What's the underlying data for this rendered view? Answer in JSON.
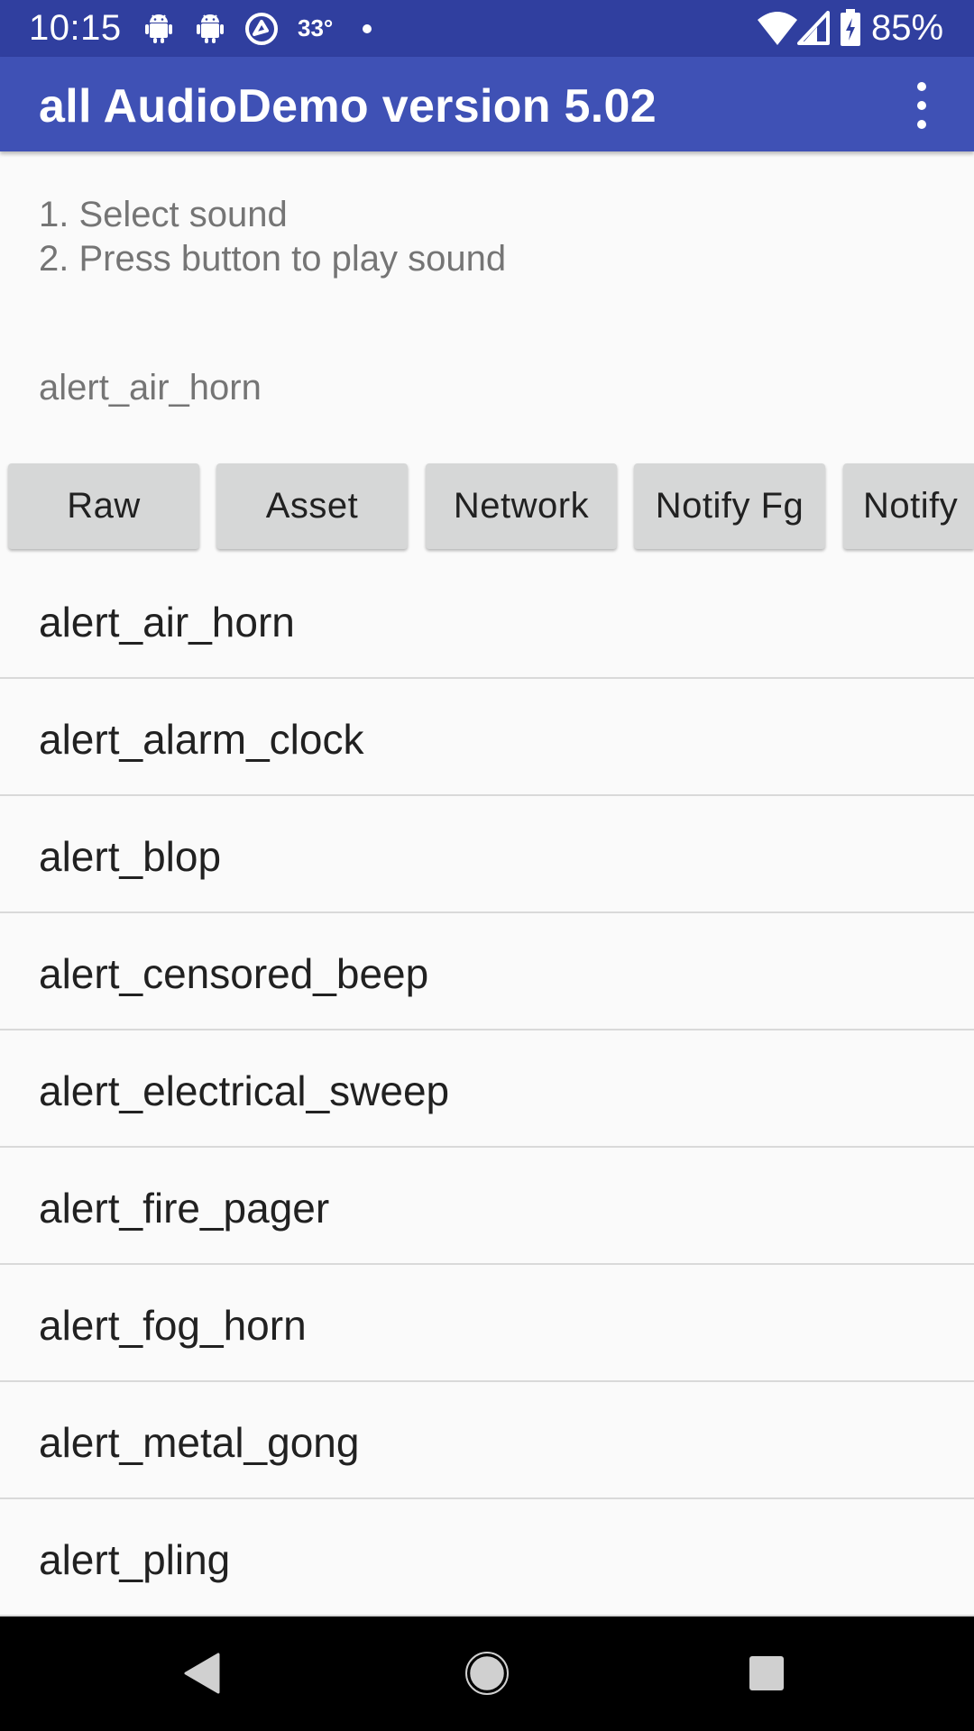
{
  "status_bar": {
    "time": "10:15",
    "temperature": "33°",
    "battery": "85%",
    "icons": [
      "android-debug-icon",
      "android-debug-icon",
      "vpn-icon",
      "wifi-icon",
      "cell-signal-icon",
      "battery-charging-icon"
    ]
  },
  "app_bar": {
    "title": "all AudioDemo version 5.02",
    "menu_icon": "more-vert-icon"
  },
  "instructions": {
    "line1": "1. Select sound",
    "line2": "2. Press button to play sound"
  },
  "selected_sound": "alert_air_horn",
  "buttons": [
    {
      "label": "Raw"
    },
    {
      "label": "Asset"
    },
    {
      "label": "Network"
    },
    {
      "label": "Notify Fg"
    },
    {
      "label": "Notify"
    }
  ],
  "sounds": [
    "alert_air_horn",
    "alert_alarm_clock",
    "alert_blop",
    "alert_censored_beep",
    "alert_electrical_sweep",
    "alert_fire_pager",
    "alert_fog_horn",
    "alert_metal_gong",
    "alert_pling"
  ],
  "navigation": {
    "back": "back-icon",
    "home": "home-icon",
    "recents": "recents-icon"
  },
  "colors": {
    "status_bar": "#303f9f",
    "app_bar": "#3f51b5",
    "button_bg": "#d6d7d7",
    "background": "#fafafa"
  }
}
